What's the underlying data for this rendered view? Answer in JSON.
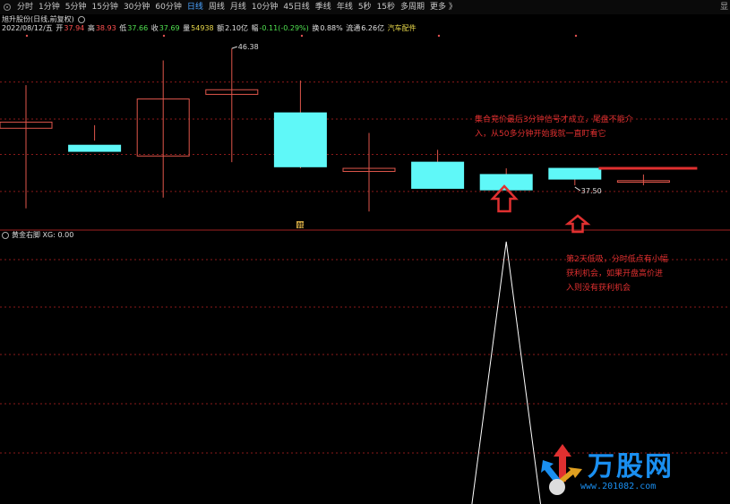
{
  "toolbar": {
    "tabs": [
      {
        "label": "分时",
        "active": false
      },
      {
        "label": "1分钟",
        "active": false
      },
      {
        "label": "5分钟",
        "active": false
      },
      {
        "label": "15分钟",
        "active": false
      },
      {
        "label": "30分钟",
        "active": false
      },
      {
        "label": "60分钟",
        "active": false
      },
      {
        "label": "日线",
        "active": true
      },
      {
        "label": "周线",
        "active": false
      },
      {
        "label": "月线",
        "active": false
      },
      {
        "label": "10分钟",
        "active": false
      },
      {
        "label": "45日线",
        "active": false
      },
      {
        "label": "季线",
        "active": false
      },
      {
        "label": "年线",
        "active": false
      },
      {
        "label": "5秒",
        "active": false
      },
      {
        "label": "15秒",
        "active": false
      },
      {
        "label": "多周期",
        "active": false
      },
      {
        "label": "更多 》",
        "active": false
      }
    ],
    "right_label": "显"
  },
  "stock": {
    "title": "旭升股份(日线,前复权)",
    "date": "2022/08/12/五",
    "open_label": "开",
    "open": "37.94",
    "high_label": "高",
    "high": "38.93",
    "low_label": "低",
    "low": "37.66",
    "close_label": "收",
    "close": "37.69",
    "volume_label": "量",
    "volume": "54938",
    "amount_label": "额",
    "amount": "2.10亿",
    "change_label": "幅",
    "change": "-0.11(-0.29%)",
    "turnover_label": "换",
    "turnover": "0.88%",
    "float_label": "流通",
    "float_cap": "6.26亿",
    "sector": "汽车配件"
  },
  "indicator": {
    "name": "黄金右脚",
    "value": "XG: 0.00"
  },
  "annotations": {
    "note1": [
      "集合竞价最后3分钟信号才成立，尾盘不能介",
      "入，从50多分钟开始我就一直盯看它"
    ],
    "note2": [
      "第2天低吸，分时低点有小幅",
      "获利机会，如果开盘高价进",
      "入则没有获利机会"
    ],
    "high_tag": "46.38",
    "low_tag": "37.50",
    "marker": "韩"
  },
  "watermark": {
    "text": "万股网",
    "url": "www.201082.com"
  },
  "colors": {
    "up": "#e0564b",
    "down": "#5ff8f8",
    "note": "#e03030",
    "grid": "#8b1a1a",
    "signal_line": "#ffffff",
    "close_line": "#e03030"
  },
  "chart_data": {
    "type": "candlestick",
    "x": [
      1,
      2,
      3,
      4,
      5,
      6,
      7,
      8,
      9,
      10
    ],
    "open": [
      41.2,
      40.1,
      39.4,
      43.4,
      42.2,
      38.4,
      39.0,
      38.2,
      38.6,
      37.7
    ],
    "high": [
      44.0,
      41.4,
      45.6,
      46.38,
      44.3,
      40.9,
      39.8,
      38.6,
      38.6,
      38.2
    ],
    "low": [
      36.0,
      40.4,
      36.7,
      39.0,
      38.6,
      35.8,
      37.9,
      37.3,
      37.5,
      37.5
    ],
    "close": [
      41.6,
      39.7,
      43.1,
      43.7,
      38.7,
      38.6,
      37.3,
      37.2,
      37.9,
      37.8
    ],
    "reference_line": 38.6,
    "grid_levels": [
      44.2,
      41.8,
      39.5,
      37.1
    ],
    "indicator_series": {
      "name": "XG",
      "x": [
        7.5,
        8.0,
        8.5
      ],
      "values": [
        0,
        1,
        0
      ]
    }
  }
}
